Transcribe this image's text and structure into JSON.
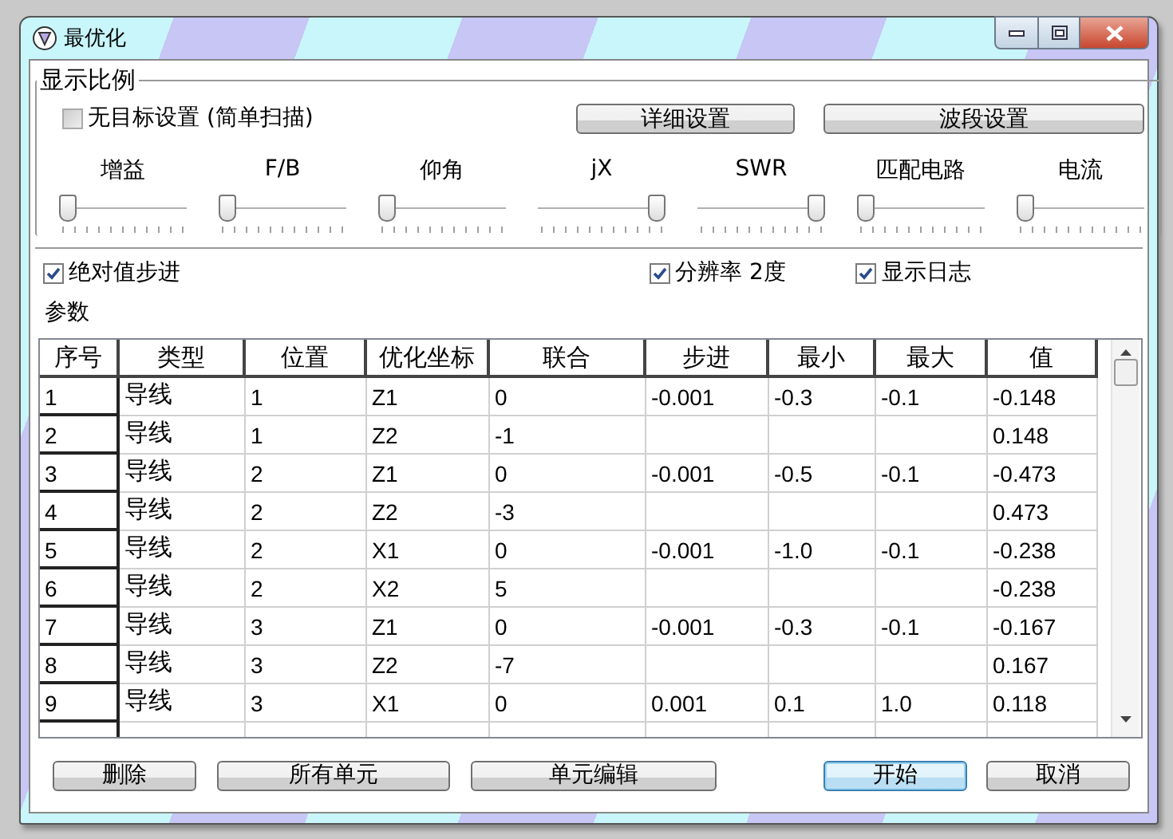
{
  "window": {
    "title": "最优化"
  },
  "display_group": {
    "title": "显示比例",
    "no_target": {
      "label": "无目标设置 (简单扫描)",
      "checked": false,
      "disabled": true
    },
    "buttons": [
      "详细设置",
      "波段设置"
    ],
    "sliders": [
      {
        "label": "增益",
        "level": 0
      },
      {
        "label": "F/B",
        "level": 0
      },
      {
        "label": "仰角",
        "level": 0
      },
      {
        "label": "jX",
        "level": 1
      },
      {
        "label": "SWR",
        "level": 1
      },
      {
        "label": "匹配电路",
        "level": 0
      },
      {
        "label": "电流",
        "level": 0
      }
    ]
  },
  "options": [
    {
      "label": "绝对值步进",
      "checked": true
    },
    {
      "label": "分辨率 2度",
      "checked": true
    },
    {
      "label": "显示日志",
      "checked": true
    }
  ],
  "params_label": "参数",
  "table": {
    "columns": [
      "序号",
      "类型",
      "位置",
      "优化坐标",
      "联合",
      "步进",
      "最小",
      "最大",
      "值"
    ],
    "rows": [
      [
        "1",
        "导线",
        "1",
        "Z1",
        "0",
        "-0.001",
        "-0.3",
        "-0.1",
        "-0.148"
      ],
      [
        "2",
        "导线",
        "1",
        "Z2",
        "-1",
        "",
        "",
        "",
        "0.148"
      ],
      [
        "3",
        "导线",
        "2",
        "Z1",
        "0",
        "-0.001",
        "-0.5",
        "-0.1",
        "-0.473"
      ],
      [
        "4",
        "导线",
        "2",
        "Z2",
        "-3",
        "",
        "",
        "",
        "0.473"
      ],
      [
        "5",
        "导线",
        "2",
        "X1",
        "0",
        "-0.001",
        "-1.0",
        "-0.1",
        "-0.238"
      ],
      [
        "6",
        "导线",
        "2",
        "X2",
        "5",
        "",
        "",
        "",
        "-0.238"
      ],
      [
        "7",
        "导线",
        "3",
        "Z1",
        "0",
        "-0.001",
        "-0.3",
        "-0.1",
        "-0.167"
      ],
      [
        "8",
        "导线",
        "3",
        "Z2",
        "-7",
        "",
        "",
        "",
        "0.167"
      ],
      [
        "9",
        "导线",
        "3",
        "X1",
        "0",
        "0.001",
        "0.1",
        "1.0",
        "0.118"
      ]
    ]
  },
  "buttons": [
    {
      "label": "删除",
      "default": false
    },
    {
      "label": "所有单元",
      "default": false
    },
    {
      "label": "单元编辑",
      "default": false
    },
    {
      "label": "开始",
      "default": true
    },
    {
      "label": "取消",
      "default": false
    }
  ]
}
